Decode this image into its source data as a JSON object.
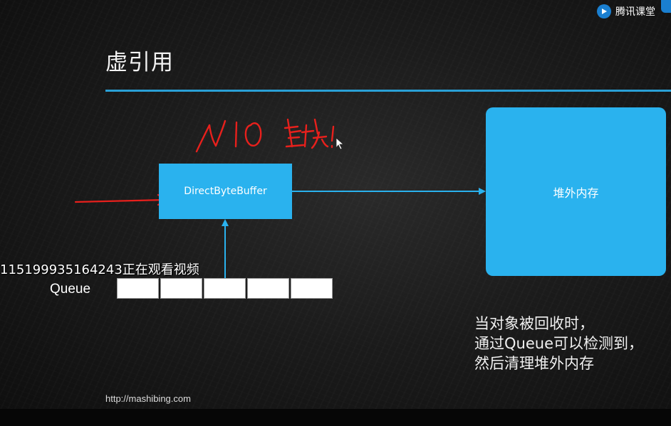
{
  "slide": {
    "title": "虚引用",
    "url": "http://mashibing.com"
  },
  "logo": {
    "text": "腾讯课堂",
    "icon": "play-icon"
  },
  "diagram": {
    "direct_buffer_label": "DirectByteBuffer",
    "heap_label": "堆外内存",
    "queue_label": "Queue",
    "queue_cells": 5
  },
  "annotation": {
    "handwritten": "NIO 直接!",
    "color": "#e8201c"
  },
  "overlay_text": "115199935164243正在观看视频",
  "note": {
    "line1": "当对象被回收时，",
    "line2": "通过Queue可以检测到，",
    "line3": "然后清理堆外内存"
  },
  "colors": {
    "accent": "#2ab2ee",
    "rule": "#2aa0d6",
    "ink": "#e8201c"
  }
}
